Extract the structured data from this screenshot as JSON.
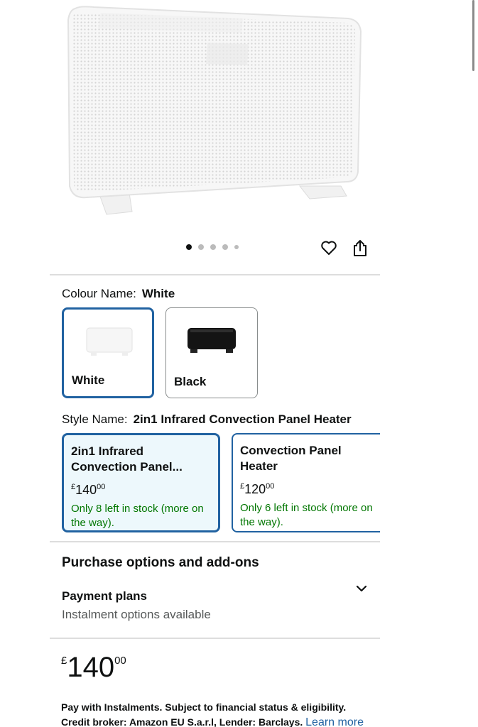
{
  "product": {
    "image_alt": "White infrared convection panel heater",
    "carousel": {
      "dots": 5,
      "active_index": 0
    }
  },
  "icons": {
    "wishlist": "heart-icon",
    "share": "share-icon",
    "expand": "chevron-down-icon"
  },
  "colour": {
    "label": "Colour Name:",
    "selected": "White",
    "options": [
      {
        "label": "White",
        "selected": true
      },
      {
        "label": "Black",
        "selected": false
      }
    ]
  },
  "style": {
    "label": "Style Name:",
    "selected": "2in1 Infrared Convection Panel Heater",
    "options": [
      {
        "title_line1": "2in1 Infrared",
        "title_line2": "Convection Panel...",
        "currency": "£",
        "price_whole": "140",
        "price_fraction": "00",
        "stock": "Only 8 left in stock (more on the way).",
        "selected": true
      },
      {
        "title_line1": "Convection Panel",
        "title_line2": "Heater",
        "currency": "£",
        "price_whole": "120",
        "price_fraction": "00",
        "stock": "Only 6 left in stock (more on the way).",
        "selected": false
      }
    ]
  },
  "purchase": {
    "title": "Purchase options and add-ons",
    "payment_title": "Payment plans",
    "payment_sub": "Instalment options available"
  },
  "price": {
    "currency": "£",
    "whole": "140",
    "fraction": "00"
  },
  "instalments": {
    "text": "Pay with Instalments. Subject to financial status & eligibility. Credit broker: Amazon EU S.a.r.l, Lender: Barclays.",
    "link": "Learn more"
  },
  "colors": {
    "accent": "#2162a1",
    "stock_green": "#007600",
    "selected_bg": "#edf8fc"
  }
}
